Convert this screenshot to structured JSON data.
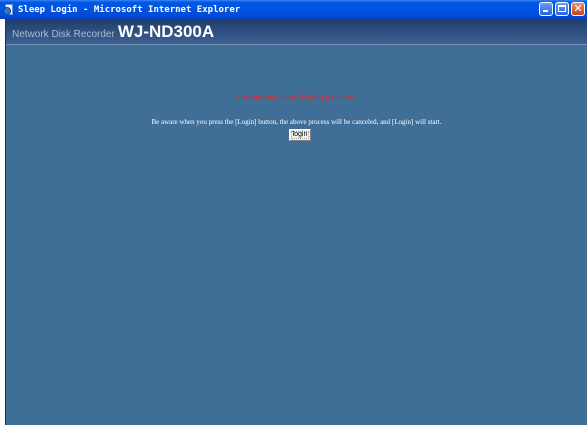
{
  "window": {
    "title": "Sleep Login - Microsoft Internet Explorer",
    "icon": "ie-icon"
  },
  "header": {
    "subtitle": "Network Disk Recorder",
    "model": "WJ-ND300A"
  },
  "messages": {
    "status": "Sleep memory process is being performed.",
    "info": "Be aware when you press the [Login] button, the above process will be canceled, and [Login] will start."
  },
  "buttons": {
    "login_label": "login"
  },
  "colors": {
    "background": "#3f6f97",
    "header": "#2b4c7c",
    "status_text": "#ff1a1a",
    "info_text": "#ffffff",
    "titlebar": "#0053e0"
  }
}
